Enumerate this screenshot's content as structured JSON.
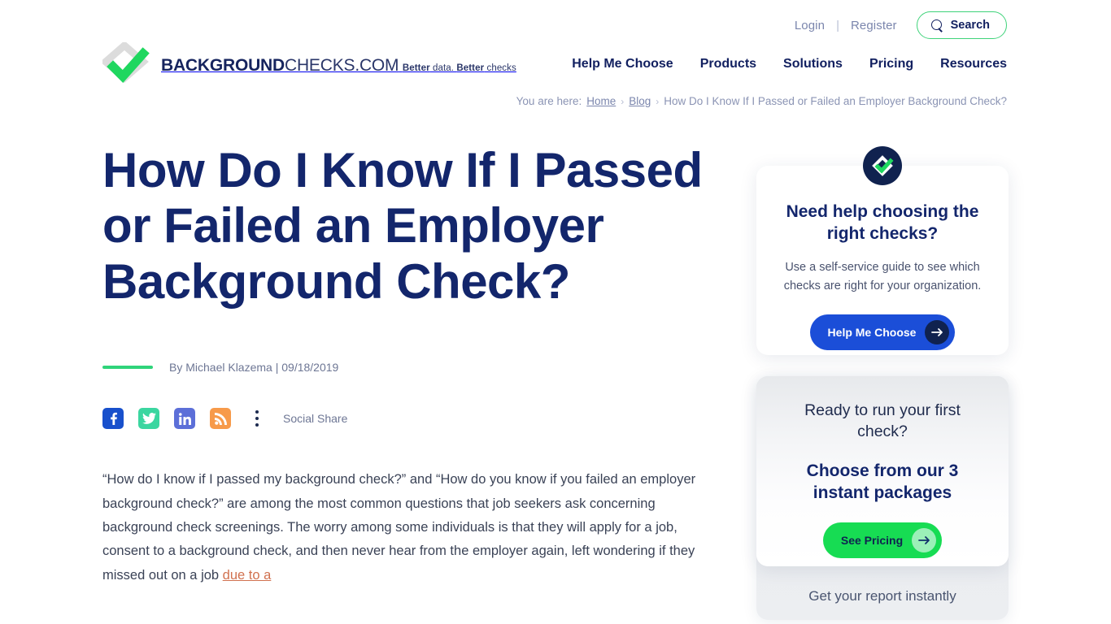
{
  "header": {
    "utility": {
      "login": "Login",
      "separator": "|",
      "register": "Register",
      "search_label": "Search",
      "search_icon": "search-icon"
    },
    "logo": {
      "title_bold": "BACKGROUND",
      "title_light": "CHECKS.COM",
      "tagline_1": "Better",
      "tagline_2": " data. ",
      "tagline_3": "Better",
      "tagline_4": " checks",
      "mark_icon": "diamond-check-logo-icon"
    },
    "nav": [
      {
        "label": "Help Me Choose"
      },
      {
        "label": "Products"
      },
      {
        "label": "Solutions"
      },
      {
        "label": "Pricing"
      },
      {
        "label": "Resources"
      }
    ]
  },
  "breadcrumb": {
    "prefix": "You are here:",
    "home": "Home",
    "blog": "Blog",
    "chevron": "›",
    "current": "How Do I Know If I Passed or Failed an Employer Background Check?"
  },
  "article": {
    "headline": "How Do I Know If I Passed or Failed an Employer Background Check?",
    "byline": "By Michael Klazema | 09/18/2019",
    "share": {
      "label": "Social Share",
      "items": [
        {
          "name": "facebook-icon",
          "color": "#1850cc"
        },
        {
          "name": "twitter-icon",
          "color": "#3bd6a0"
        },
        {
          "name": "linkedin-icon",
          "color": "#5c6fd8"
        },
        {
          "name": "rss-icon",
          "color": "#f79a4a"
        }
      ],
      "more_icon": "kebab-menu-icon"
    },
    "paragraph_1": "“How do I know if I passed my background check?” and “How do you know if you failed an employer background check?” are among the most common questions that job seekers ask concerning background check screenings. The worry among some individuals is that they will apply for a job, consent to a background check, and then never hear from the employer again, left wondering if they missed out on a job ",
    "paragraph_1_link": "due to a"
  },
  "sidebar": {
    "card_help": {
      "badge_icon": "diamond-check-badge-icon",
      "title": "Need help choosing the right checks?",
      "subtitle": "Use a self-service guide to see which checks are right for your organization.",
      "cta_label": "Help Me Choose",
      "cta_icon": "arrow-right-icon",
      "cta_color": "#1b4ed8"
    },
    "card_pricing": {
      "lead": "Ready to run your first check?",
      "title": "Choose from our 3 instant packages",
      "cta_label": "See Pricing",
      "cta_icon": "arrow-right-icon",
      "cta_color": "#17dc53",
      "footer_text": "Get your report instantly"
    }
  }
}
